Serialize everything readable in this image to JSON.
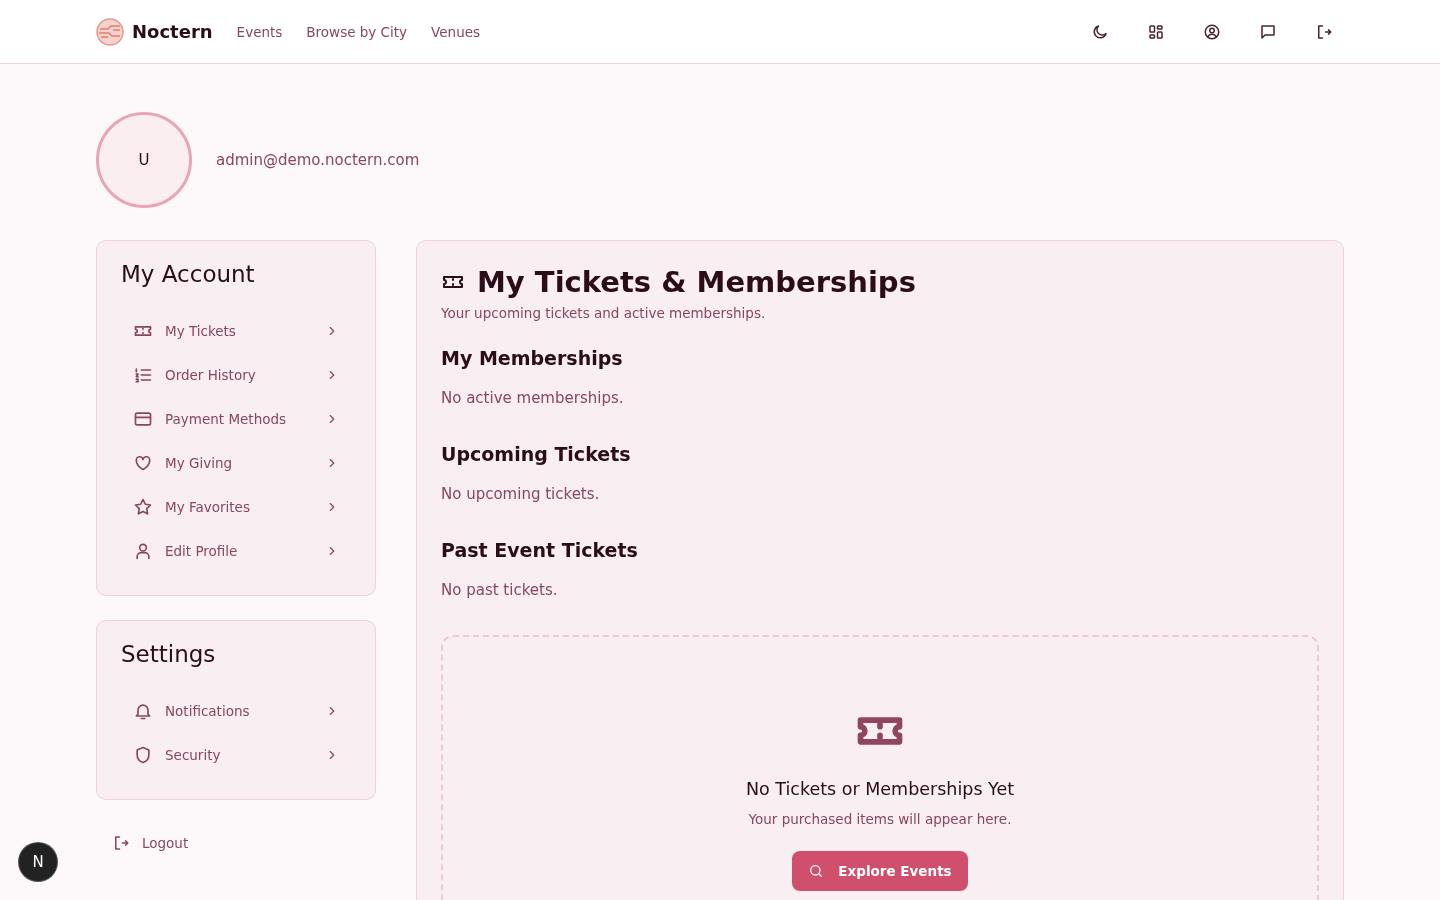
{
  "header": {
    "brand": "Noctern",
    "nav": [
      "Events",
      "Browse by City",
      "Venues"
    ]
  },
  "profile": {
    "avatar_initial": "U",
    "email": "admin@demo.noctern.com"
  },
  "account_menu": {
    "title": "My Account",
    "items": [
      "My Tickets",
      "Order History",
      "Payment Methods",
      "My Giving",
      "My Favorites",
      "Edit Profile"
    ]
  },
  "settings_menu": {
    "title": "Settings",
    "items": [
      "Notifications",
      "Security"
    ]
  },
  "logout": "Logout",
  "main": {
    "title": "My Tickets & Memberships",
    "subtitle": "Your upcoming tickets and active memberships.",
    "sections": [
      {
        "heading": "My Memberships",
        "message": "No active memberships."
      },
      {
        "heading": "Upcoming Tickets",
        "message": "No upcoming tickets."
      },
      {
        "heading": "Past Event Tickets",
        "message": "No past tickets."
      }
    ],
    "empty_state": {
      "title": "No Tickets or Memberships Yet",
      "text": "Your purchased items will appear here.",
      "button": "Explore Events"
    }
  },
  "dev_badge": "N"
}
